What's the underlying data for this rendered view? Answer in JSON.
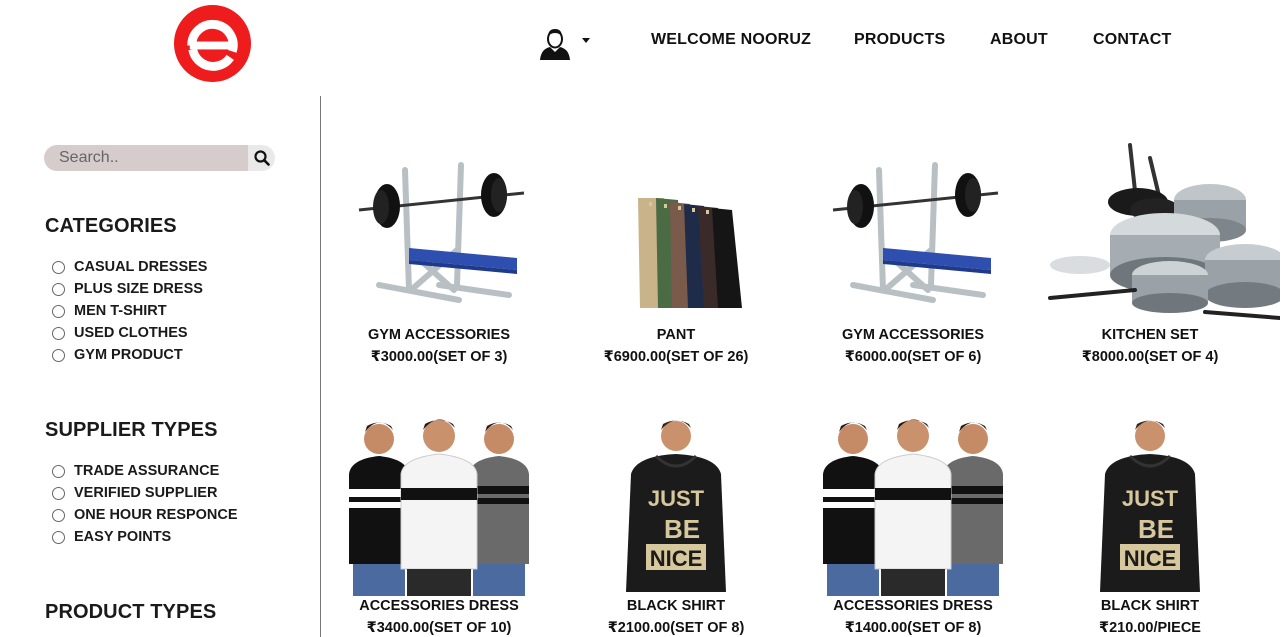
{
  "header": {
    "nav": {
      "welcome": "WELCOME NOORUZ",
      "products": "PRODUCTS",
      "about": "ABOUT",
      "contact": "CONTACT"
    }
  },
  "search": {
    "placeholder": "Search.."
  },
  "sidebar": {
    "categories": {
      "title": "CATEGORIES",
      "items": [
        "CASUAL DRESSES",
        "PLUS SIZE DRESS",
        "MEN T-SHIRT",
        "USED CLOTHES",
        "GYM PRODUCT"
      ]
    },
    "supplier_types": {
      "title": "SUPPLIER TYPES",
      "items": [
        "TRADE ASSURANCE",
        "VERIFIED SUPPLIER",
        "ONE HOUR RESPONCE",
        "EASY POINTS"
      ]
    },
    "product_types": {
      "title": "PRODUCT TYPES"
    }
  },
  "products": [
    {
      "name": "GYM ACCESSORIES",
      "price": "₹3000.00(SET OF 3)",
      "image": "weight-bench-image"
    },
    {
      "name": "PANT",
      "price": "₹6900.00(SET OF 26)",
      "image": "pants-stack-image"
    },
    {
      "name": "GYM ACCESSORIES",
      "price": "₹6000.00(SET OF 6)",
      "image": "weight-bench-image"
    },
    {
      "name": "KITCHEN SET",
      "price": "₹8000.00(SET OF 4)",
      "image": "cookware-set-image"
    },
    {
      "name": "ACCESSORIES DRESS",
      "price": "₹3400.00(SET OF 10)",
      "image": "tshirt-models-image"
    },
    {
      "name": "BLACK SHIRT",
      "price": "₹2100.00(SET OF 8)",
      "image": "black-hoodie-image"
    },
    {
      "name": "ACCESSORIES DRESS",
      "price": "₹1400.00(SET OF 8)",
      "image": "tshirt-models-image"
    },
    {
      "name": "BLACK SHIRT",
      "price": "₹210.00/PIECE",
      "image": "black-hoodie-image"
    }
  ],
  "hoodie_print": [
    "JUST",
    "BE",
    "NICE"
  ],
  "colors": {
    "brand": "#ee1c1c",
    "search_bg": "#d6cccc",
    "bench_blue": "#2f4fb0"
  }
}
